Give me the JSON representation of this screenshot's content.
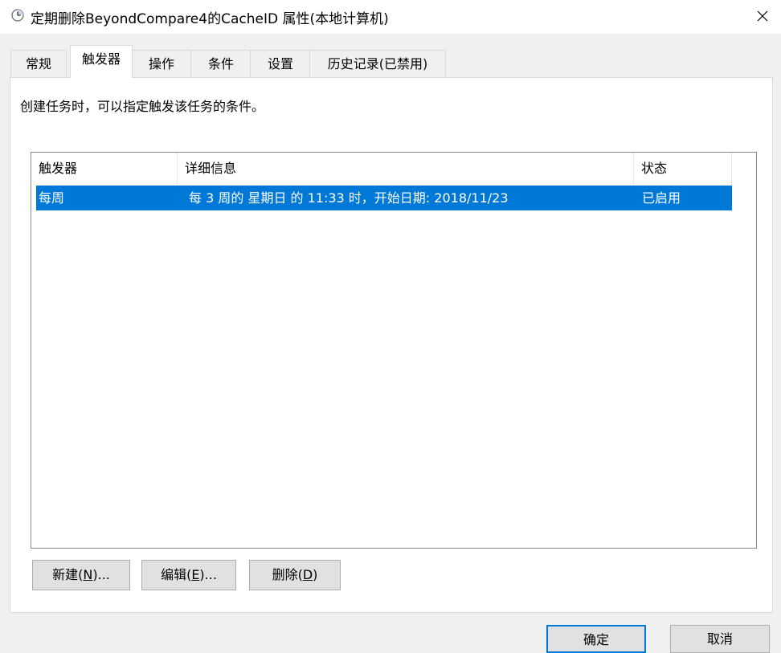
{
  "window": {
    "title": "定期删除BeyondCompare4的CacheID 属性(本地计算机)",
    "close_symbol": "✕"
  },
  "tabs": [
    {
      "label": "常规",
      "active": false
    },
    {
      "label": "触发器",
      "active": true
    },
    {
      "label": "操作",
      "active": false
    },
    {
      "label": "条件",
      "active": false
    },
    {
      "label": "设置",
      "active": false
    },
    {
      "label": "历史记录(已禁用)",
      "active": false
    }
  ],
  "triggers_panel": {
    "description": "创建任务时，可以指定触发该任务的条件。",
    "columns": [
      "触发器",
      "详细信息",
      "状态"
    ],
    "rows": [
      {
        "trigger": "每周",
        "details": "每 3 周的 星期日 的 11:33 时，开始日期: 2018/11/23",
        "status": "已启用",
        "selected": true
      }
    ],
    "buttons": {
      "new": {
        "label": "新建(",
        "mnemonic": "N",
        "suffix": ")..."
      },
      "edit": {
        "label": "编辑(",
        "mnemonic": "E",
        "suffix": ")..."
      },
      "delete": {
        "label": "删除(",
        "mnemonic": "D",
        "suffix": ")"
      }
    }
  },
  "footer": {
    "ok_label": "确定",
    "cancel_label": "取消"
  },
  "colors": {
    "selection": "#0078d7",
    "window_bg": "#f0f0f0",
    "panel_bg": "#ffffff"
  },
  "icons": {
    "title": "scheduled-task-clock-icon",
    "close": "close-icon"
  }
}
